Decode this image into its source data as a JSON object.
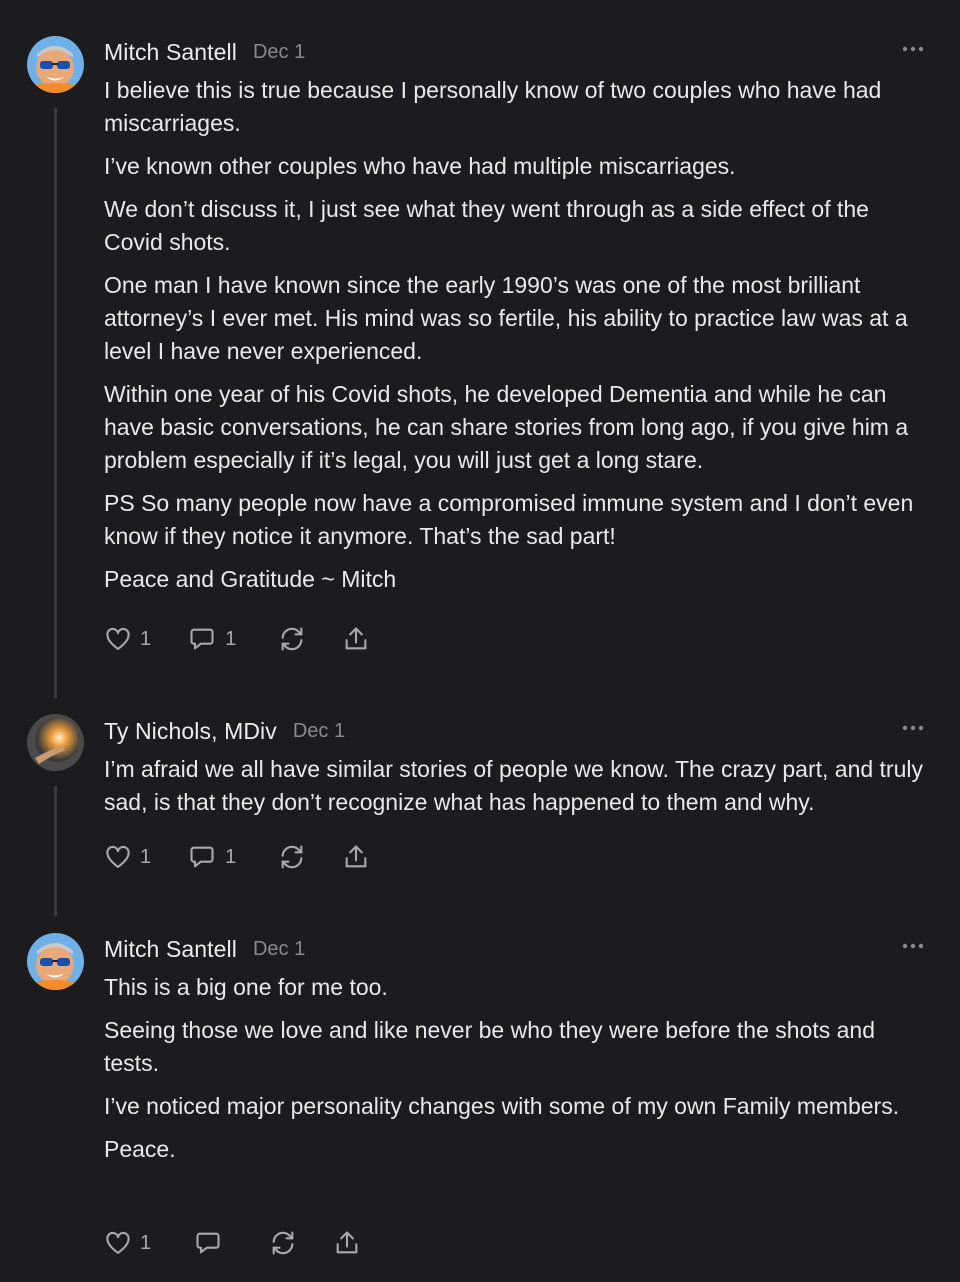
{
  "comments": [
    {
      "author": "Mitch Santell",
      "date": "Dec 1",
      "avatar": "mitch-avatar",
      "paragraphs": [
        "I believe this is true because I personally know of two couples who have had miscarriages.",
        "I’ve known other couples who have had multiple miscarriages.",
        "We don’t discuss it, I just see what they went through as a side effect of the Covid shots.",
        "One man I have known since the early 1990’s was one of the most brilliant attorney’s I ever met. His mind was so fertile, his ability to practice law was at a level I have never experienced.",
        "Within one year of his Covid shots, he developed Dementia and while he can have basic conversations, he can share stories from long ago, if you give him a problem especially if it’s legal, you will just get a long stare.",
        "PS So many people now have a compromised immune system and I don’t even know if they notice it anymore. That’s the sad part!",
        "Peace and Gratitude ~ Mitch"
      ],
      "likes": "1",
      "replies": "1"
    },
    {
      "author": "Ty Nichols, MDiv",
      "date": "Dec 1",
      "avatar": "ty-avatar",
      "paragraphs": [
        "I’m afraid we all have similar stories of people we know. The crazy part, and truly sad, is that they don’t recognize what has happened to them and why."
      ],
      "likes": "1",
      "replies": "1"
    },
    {
      "author": "Mitch Santell",
      "date": "Dec 1",
      "avatar": "mitch-avatar",
      "paragraphs": [
        "This is a big one for me too.",
        "Seeing those we love and like never be who they were before the shots and tests.",
        "I’ve noticed major personality changes with some of my own Family members.",
        "Peace."
      ],
      "likes": "1",
      "replies": ""
    }
  ],
  "icons": {
    "like": "heart-icon",
    "reply": "comment-icon",
    "restack": "restack-icon",
    "share": "share-icon",
    "more": "more-icon"
  },
  "colors": {
    "background": "#1c1c1e",
    "text": "#e9e9e9",
    "muted": "#8a8a8e",
    "thread_line": "#3a3a3c"
  }
}
